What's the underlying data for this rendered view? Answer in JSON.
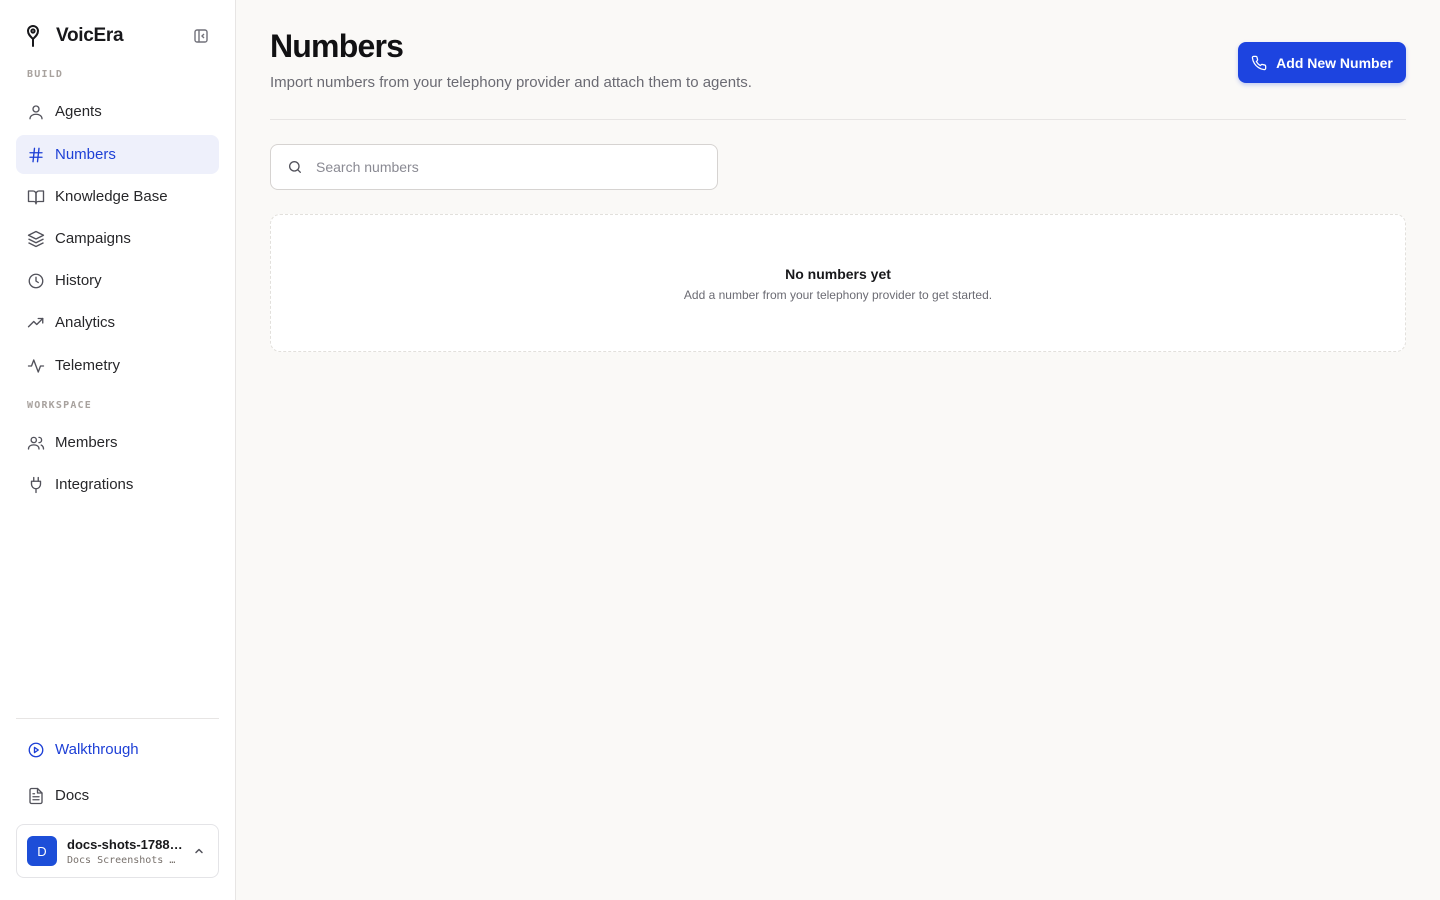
{
  "app": {
    "name": "VoicEra"
  },
  "sidebar": {
    "sections": [
      {
        "label": "BUILD"
      },
      {
        "label": "WORKSPACE"
      }
    ],
    "build_items": [
      {
        "label": "Agents",
        "icon": "user-icon"
      },
      {
        "label": "Numbers",
        "icon": "hash-icon",
        "active": true
      },
      {
        "label": "Knowledge Base",
        "icon": "book-icon"
      },
      {
        "label": "Campaigns",
        "icon": "layers-icon"
      },
      {
        "label": "History",
        "icon": "clock-icon"
      },
      {
        "label": "Analytics",
        "icon": "trending-up-icon"
      },
      {
        "label": "Telemetry",
        "icon": "activity-icon"
      }
    ],
    "workspace_items": [
      {
        "label": "Members",
        "icon": "users-icon"
      },
      {
        "label": "Integrations",
        "icon": "plug-icon"
      }
    ],
    "footer_items": [
      {
        "label": "Walkthrough",
        "icon": "play-circle-icon"
      },
      {
        "label": "Docs",
        "icon": "file-text-icon"
      }
    ],
    "workspace": {
      "avatar": "D",
      "name": "docs-shots-1788…",
      "subtitle": "Docs Screenshots …"
    }
  },
  "main": {
    "title": "Numbers",
    "subtitle": "Import numbers from your telephony provider and attach them to agents.",
    "add_button_label": "Add New Number",
    "search": {
      "placeholder": "Search numbers",
      "value": ""
    },
    "empty_state": {
      "title": "No numbers yet",
      "description": "Add a number from your telephony provider to get started."
    }
  },
  "colors": {
    "accent": "#1d44e0",
    "active_nav_bg": "#eef0fb",
    "background": "#faf9f7"
  }
}
